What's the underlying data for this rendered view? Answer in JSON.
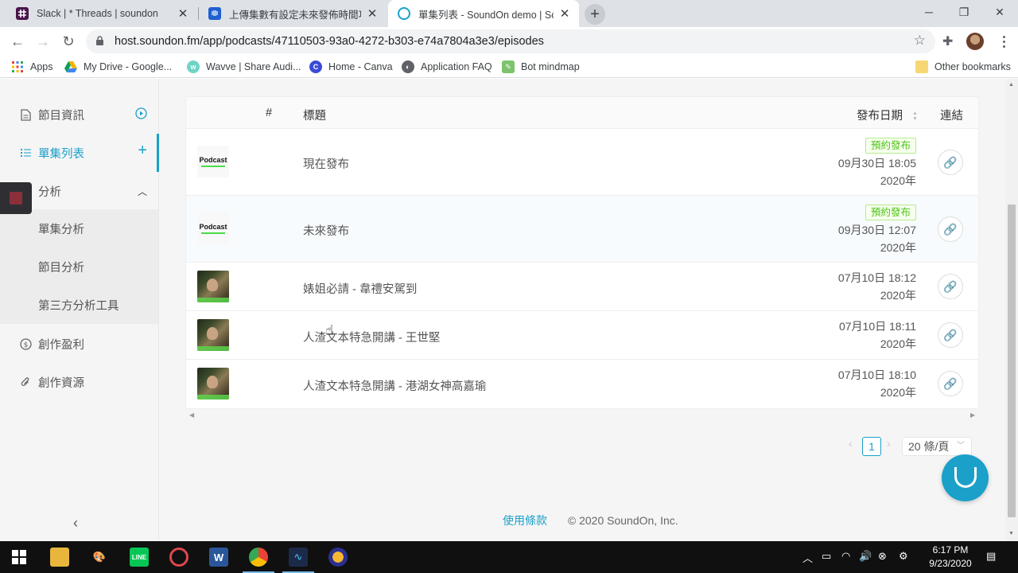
{
  "browser": {
    "tabs": [
      {
        "title": "Slack | * Threads | soundon",
        "favicon": "slack-icon",
        "favicon_color": "#4a154b",
        "active": false
      },
      {
        "title": "上傳集數有設定未來發佈時間功能",
        "favicon": "intercom-icon",
        "favicon_color": "#1f5fd1",
        "active": false
      },
      {
        "title": "單集列表 - SoundOn demo | SoundOn",
        "favicon": "soundon-icon",
        "favicon_color": "#1aa0c9",
        "active": true
      }
    ],
    "url": "host.soundon.fm/app/podcasts/47110503-93a0-4272-b303-e74a7804a3e3/episodes",
    "bookmarks": [
      {
        "label": "Apps",
        "icon": "apps-grid-icon",
        "color": "#4285f4"
      },
      {
        "label": "My Drive - Google...",
        "icon": "google-drive-icon",
        "color": "#f4b400"
      },
      {
        "label": "Wavve | Share Audi...",
        "icon": "wavve-icon",
        "color": "#6fd3c5"
      },
      {
        "label": "Home - Canva",
        "icon": "canva-icon",
        "color": "#3b4bd8"
      },
      {
        "label": "Application FAQ",
        "icon": "globe-icon",
        "color": "#5f6368"
      },
      {
        "label": "Bot mindmap",
        "icon": "mindmap-icon",
        "color": "#7cc36b"
      }
    ],
    "other_bookmarks": "Other bookmarks"
  },
  "sidebar": {
    "items": [
      {
        "label": "節目資訊",
        "icon": "document-icon",
        "right_icon": "play-circle-icon"
      },
      {
        "label": "單集列表",
        "icon": "list-icon",
        "right_icon": "plus-icon"
      },
      {
        "label": "分析",
        "icon": "chart-icon",
        "right_icon": "chevron-up-icon"
      },
      {
        "label": "創作盈利",
        "icon": "dollar-icon",
        "right_icon": ""
      },
      {
        "label": "創作資源",
        "icon": "paperclip-icon",
        "right_icon": ""
      }
    ],
    "sub_items": [
      "單集分析",
      "節目分析",
      "第三方分析工具"
    ]
  },
  "table": {
    "headers": {
      "num": "#",
      "title": "標題",
      "date": "發布日期",
      "link": "連結"
    },
    "rows": [
      {
        "thumb": "podcast",
        "thumb_text": "Podcast",
        "title": "現在發布",
        "badge": "預約發布",
        "date": "09月30日 18:05",
        "year": "2020年"
      },
      {
        "thumb": "podcast",
        "thumb_text": "Podcast",
        "title": "未來發布",
        "badge": "預約發布",
        "date": "09月30日 12:07",
        "year": "2020年"
      },
      {
        "thumb": "video",
        "thumb_text": "",
        "title": "婊姐必請 - 韋禮安駕到",
        "badge": "",
        "date": "07月10日 18:12",
        "year": "2020年"
      },
      {
        "thumb": "video",
        "thumb_text": "",
        "title": "人渣文本特急開講 - 王世堅",
        "badge": "",
        "date": "07月10日 18:11",
        "year": "2020年"
      },
      {
        "thumb": "video",
        "thumb_text": "",
        "title": "人渣文本特急開講 - 港湖女神高嘉瑜",
        "badge": "",
        "date": "07月10日 18:10",
        "year": "2020年"
      }
    ]
  },
  "pagination": {
    "current": "1",
    "page_size": "20 條/頁"
  },
  "footer": {
    "terms": "使用條款",
    "copyright": "© 2020 SoundOn, Inc."
  },
  "taskbar": {
    "time": "6:17 PM",
    "date": "9/23/2020"
  },
  "colors": {
    "accent": "#1aa0c9",
    "badge_green": "#52c41a"
  }
}
